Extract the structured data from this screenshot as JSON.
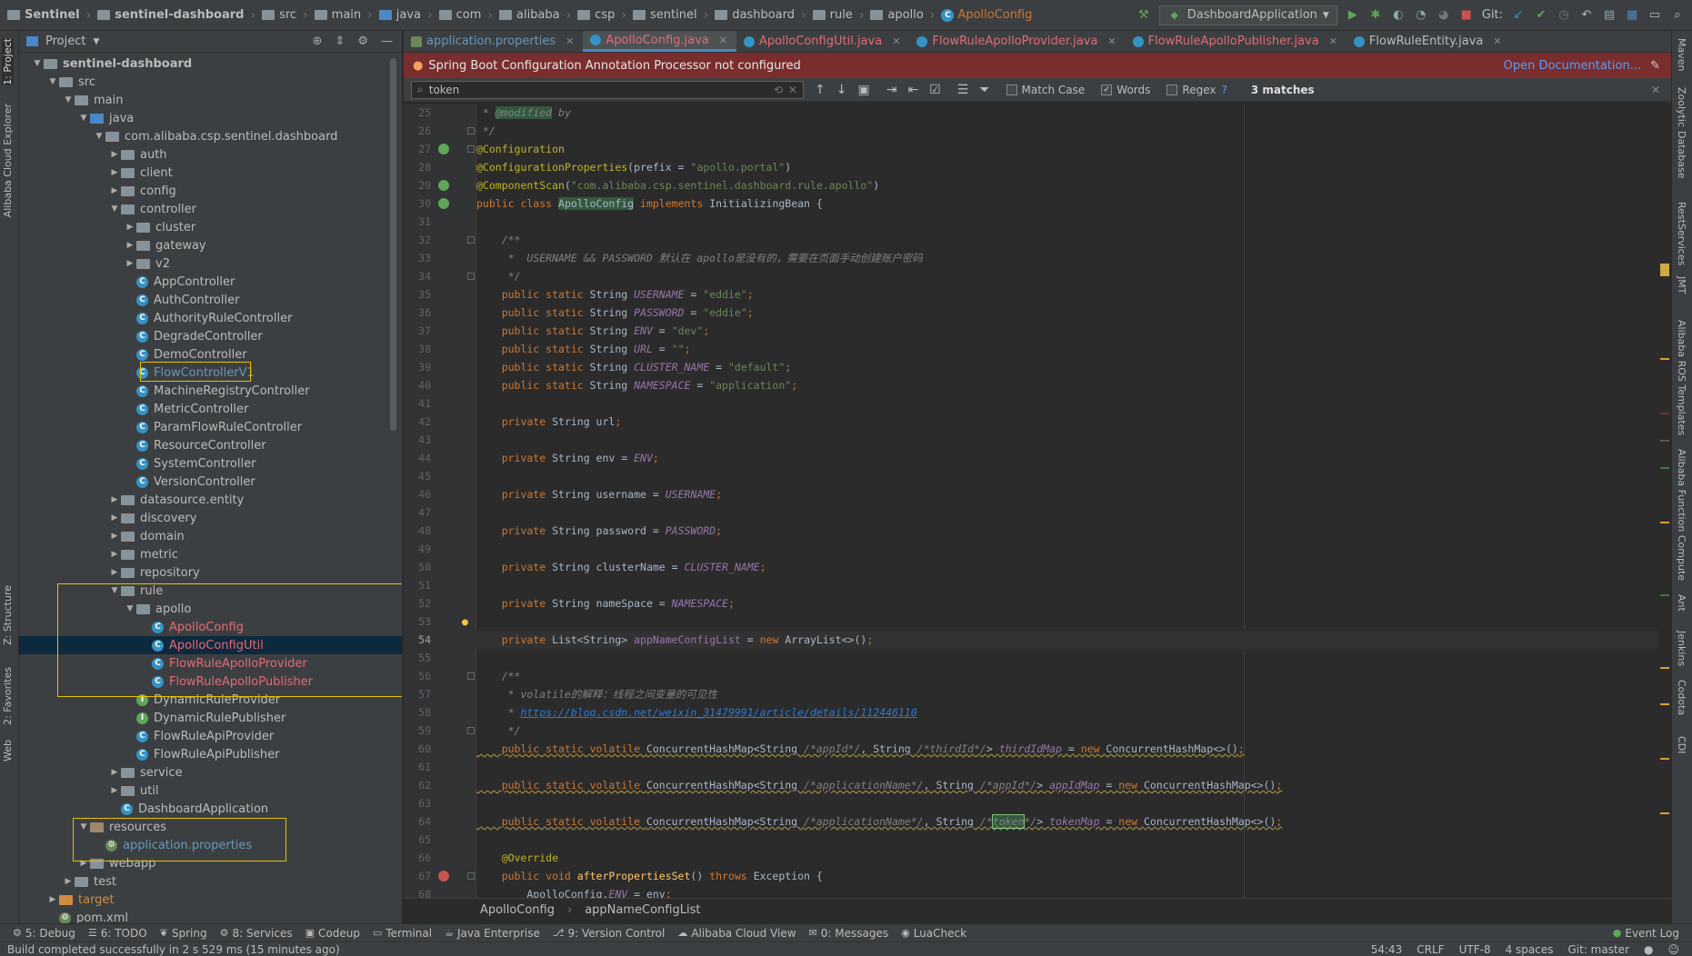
{
  "navbar": {
    "crumbs": [
      "Sentinel",
      "sentinel-dashboard",
      "src",
      "main",
      "java",
      "com",
      "alibaba",
      "csp",
      "sentinel",
      "dashboard",
      "rule",
      "apollo"
    ],
    "active_file": "ApolloConfig",
    "run_config": "DashboardApplication",
    "git_label": "Git:"
  },
  "left_stripe": {
    "project": "1: Project",
    "cloud": "Alibaba Cloud Explorer",
    "structure": "Z: Structure",
    "favorites": "2: Favorites",
    "web": "Web"
  },
  "project_panel": {
    "title": "Project",
    "tree": [
      {
        "label": "sentinel-dashboard",
        "depth": 1,
        "kind": "folder",
        "open": true,
        "bold": true
      },
      {
        "label": "src",
        "depth": 2,
        "kind": "folder",
        "open": true
      },
      {
        "label": "main",
        "depth": 3,
        "kind": "folder",
        "open": true
      },
      {
        "label": "java",
        "depth": 4,
        "kind": "src",
        "open": true
      },
      {
        "label": "com.alibaba.csp.sentinel.dashboard",
        "depth": 5,
        "kind": "folder",
        "open": true
      },
      {
        "label": "auth",
        "depth": 6,
        "kind": "folder",
        "open": false
      },
      {
        "label": "client",
        "depth": 6,
        "kind": "folder",
        "open": false
      },
      {
        "label": "config",
        "depth": 6,
        "kind": "folder",
        "open": false
      },
      {
        "label": "controller",
        "depth": 6,
        "kind": "folder",
        "open": true
      },
      {
        "label": "cluster",
        "depth": 7,
        "kind": "folder",
        "open": false
      },
      {
        "label": "gateway",
        "depth": 7,
        "kind": "folder",
        "open": false
      },
      {
        "label": "v2",
        "depth": 7,
        "kind": "folder",
        "open": false
      },
      {
        "label": "AppController",
        "depth": 7,
        "kind": "class"
      },
      {
        "label": "AuthController",
        "depth": 7,
        "kind": "class"
      },
      {
        "label": "AuthorityRuleController",
        "depth": 7,
        "kind": "class"
      },
      {
        "label": "DegradeController",
        "depth": 7,
        "kind": "class"
      },
      {
        "label": "DemoController",
        "depth": 7,
        "kind": "class"
      },
      {
        "label": "FlowControllerV1",
        "depth": 7,
        "kind": "class",
        "color": "mod"
      },
      {
        "label": "MachineRegistryController",
        "depth": 7,
        "kind": "class"
      },
      {
        "label": "MetricController",
        "depth": 7,
        "kind": "class"
      },
      {
        "label": "ParamFlowRuleController",
        "depth": 7,
        "kind": "class"
      },
      {
        "label": "ResourceController",
        "depth": 7,
        "kind": "class"
      },
      {
        "label": "SystemController",
        "depth": 7,
        "kind": "class"
      },
      {
        "label": "VersionController",
        "depth": 7,
        "kind": "class"
      },
      {
        "label": "datasource.entity",
        "depth": 6,
        "kind": "folder",
        "open": false
      },
      {
        "label": "discovery",
        "depth": 6,
        "kind": "folder",
        "open": false
      },
      {
        "label": "domain",
        "depth": 6,
        "kind": "folder",
        "open": false
      },
      {
        "label": "metric",
        "depth": 6,
        "kind": "folder",
        "open": false
      },
      {
        "label": "repository",
        "depth": 6,
        "kind": "folder",
        "open": false
      },
      {
        "label": "rule",
        "depth": 6,
        "kind": "folder",
        "open": true
      },
      {
        "label": "apollo",
        "depth": 7,
        "kind": "folder",
        "open": true
      },
      {
        "label": "ApolloConfig",
        "depth": 8,
        "kind": "class",
        "color": "red"
      },
      {
        "label": "ApolloConfigUtil",
        "depth": 8,
        "kind": "class",
        "color": "red",
        "selected": true
      },
      {
        "label": "FlowRuleApolloProvider",
        "depth": 8,
        "kind": "class",
        "color": "red"
      },
      {
        "label": "FlowRuleApolloPublisher",
        "depth": 8,
        "kind": "class",
        "color": "red"
      },
      {
        "label": "DynamicRuleProvider",
        "depth": 7,
        "kind": "iface"
      },
      {
        "label": "DynamicRulePublisher",
        "depth": 7,
        "kind": "iface"
      },
      {
        "label": "FlowRuleApiProvider",
        "depth": 7,
        "kind": "class"
      },
      {
        "label": "FlowRuleApiPublisher",
        "depth": 7,
        "kind": "class"
      },
      {
        "label": "service",
        "depth": 6,
        "kind": "folder",
        "open": false
      },
      {
        "label": "util",
        "depth": 6,
        "kind": "folder",
        "open": false
      },
      {
        "label": "DashboardApplication",
        "depth": 6,
        "kind": "class"
      },
      {
        "label": "resources",
        "depth": 4,
        "kind": "res",
        "open": true
      },
      {
        "label": "application.properties",
        "depth": 5,
        "kind": "prop",
        "color": "mod"
      },
      {
        "label": "webapp",
        "depth": 4,
        "kind": "folder",
        "open": false
      },
      {
        "label": "test",
        "depth": 3,
        "kind": "folder",
        "open": false
      },
      {
        "label": "target",
        "depth": 2,
        "kind": "target",
        "open": false,
        "color": "target"
      },
      {
        "label": "pom.xml",
        "depth": 2,
        "kind": "prop"
      }
    ]
  },
  "editor": {
    "tabs": [
      {
        "label": "application.properties",
        "icon": "prop",
        "color": "mod"
      },
      {
        "label": "ApolloConfig.java",
        "icon": "class",
        "color": "red",
        "active": true
      },
      {
        "label": "ApolloConfigUtil.java",
        "icon": "class",
        "color": "red"
      },
      {
        "label": "FlowRuleApolloProvider.java",
        "icon": "class",
        "color": "red"
      },
      {
        "label": "FlowRuleApolloPublisher.java",
        "icon": "class",
        "color": "red"
      },
      {
        "label": "FlowRuleEntity.java",
        "icon": "class",
        "color": "none"
      }
    ],
    "notification": "Spring Boot Configuration Annotation Processor not configured",
    "notification_link": "Open Documentation...",
    "find": {
      "query": "token",
      "match_case": "Match Case",
      "words": "Words",
      "regex": "Regex",
      "help": "?",
      "matches": "3 matches"
    },
    "breadcrumb": [
      "ApolloConfig",
      "appNameConfigList"
    ]
  },
  "right_stripe": [
    "Maven",
    "Zoolytic",
    "Database",
    "RestServices",
    "JMT",
    "Alibaba ROS Templates",
    "Alibaba Function Compute",
    "Ant",
    "Jenkins",
    "Codota",
    "CDI"
  ],
  "toolwindows": [
    {
      "label": "5: Debug",
      "icon": "⚙"
    },
    {
      "label": "6: TODO",
      "icon": "☰"
    },
    {
      "label": "Spring",
      "icon": "❦"
    },
    {
      "label": "8: Services",
      "icon": "⚙"
    },
    {
      "label": "Codeup",
      "icon": "▣"
    },
    {
      "label": "Terminal",
      "icon": "▭"
    },
    {
      "label": "Java Enterprise",
      "icon": "☕"
    },
    {
      "label": "9: Version Control",
      "icon": "⎇"
    },
    {
      "label": "Alibaba Cloud View",
      "icon": "☁"
    },
    {
      "label": "0: Messages",
      "icon": "✉"
    },
    {
      "label": "LuaCheck",
      "icon": "◉"
    }
  ],
  "event_log": "Event Log",
  "status": {
    "message": "Build completed successfully in 2 s 529 ms (15 minutes ago)",
    "position": "54:43",
    "line_sep": "CRLF",
    "encoding": "UTF-8",
    "indent": "4 spaces",
    "branch": "Git: master"
  }
}
